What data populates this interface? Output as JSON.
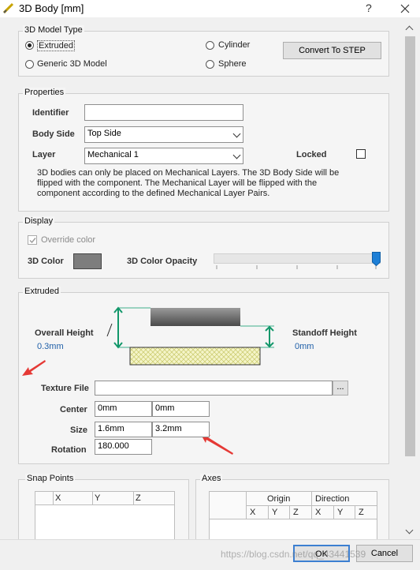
{
  "window": {
    "title": "3D Body [mm]",
    "help_glyph": "?",
    "close_glyph": "X"
  },
  "model_type": {
    "group_label": "3D Model Type",
    "options": {
      "extruded": "Extruded",
      "generic": "Generic 3D Model",
      "cylinder": "Cylinder",
      "sphere": "Sphere"
    },
    "selected": "Extruded",
    "convert_button": "Convert To STEP"
  },
  "properties": {
    "group_label": "Properties",
    "identifier_label": "Identifier",
    "identifier_value": "",
    "body_side_label": "Body Side",
    "body_side_value": "Top Side",
    "layer_label": "Layer",
    "layer_value": "Mechanical 1",
    "locked_label": "Locked",
    "locked": false,
    "note_line1": "3D bodies can only be placed on Mechanical Layers. The 3D Body Side will be",
    "note_line2": "flipped with the component. The Mechanical Layer will be flipped with the",
    "note_line3": "component according to the defined Mechanical Layer Pairs."
  },
  "display": {
    "group_label": "Display",
    "override_label": "Override color",
    "override_checked": true,
    "color_label": "3D Color",
    "color_value": "#7d7d7d",
    "opacity_label": "3D Color Opacity",
    "opacity_level": 1.0
  },
  "extruded": {
    "group_label": "Extruded",
    "overall_height_label": "Overall Height",
    "overall_height_value": "0.3mm",
    "standoff_height_label": "Standoff Height",
    "standoff_height_value": "0mm",
    "texture_file_label": "Texture File",
    "texture_file_value": "",
    "browse_label": "...",
    "center_label": "Center",
    "center_x": "0mm",
    "center_y": "0mm",
    "size_label": "Size",
    "size_x": "1.6mm",
    "size_y": "3.2mm",
    "rotation_label": "Rotation",
    "rotation_value": "180.000"
  },
  "snap_points": {
    "group_label": "Snap Points",
    "columns": [
      "X",
      "Y",
      "Z"
    ]
  },
  "axes": {
    "group_label": "Axes",
    "header_groups": [
      "Origin",
      "Direction"
    ],
    "columns": [
      "X",
      "Y",
      "Z",
      "X",
      "Y",
      "Z"
    ]
  },
  "footer": {
    "ok_label": "OK",
    "cancel_label": "Cancel",
    "watermark": "https://blog.csdn.net/qq_43441539"
  }
}
